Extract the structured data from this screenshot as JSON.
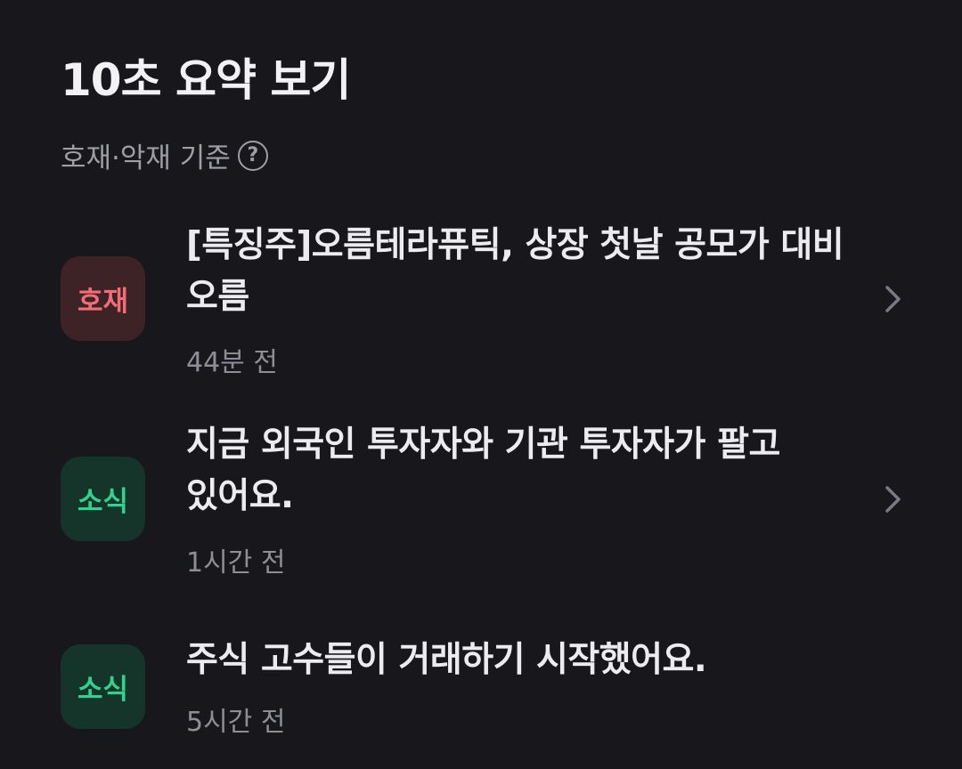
{
  "header": {
    "title": "10초 요약 보기",
    "criteria_label": "호재·악재 기준",
    "help_icon": "question-circle-icon"
  },
  "items": [
    {
      "badge": "호재",
      "badge_color": "#f26d78",
      "headline": "[특징주]오름테라퓨틱, 상장 첫날 공모가 대비 오름",
      "time": "44분 전",
      "has_chevron": true
    },
    {
      "badge": "소식",
      "badge_color": "#2fd391",
      "headline": "지금 외국인 투자자와 기관 투자자가 팔고 있어요.",
      "time": "1시간 전",
      "has_chevron": true
    },
    {
      "badge": "소식",
      "badge_color": "#2fd391",
      "headline": "주식 고수들이 거래하기 시작했어요.",
      "time": "5시간 전",
      "has_chevron": false
    }
  ],
  "colors": {
    "background": "#17171c",
    "good_badge_bg": "#3d2226",
    "news_badge_bg": "#16352a"
  }
}
